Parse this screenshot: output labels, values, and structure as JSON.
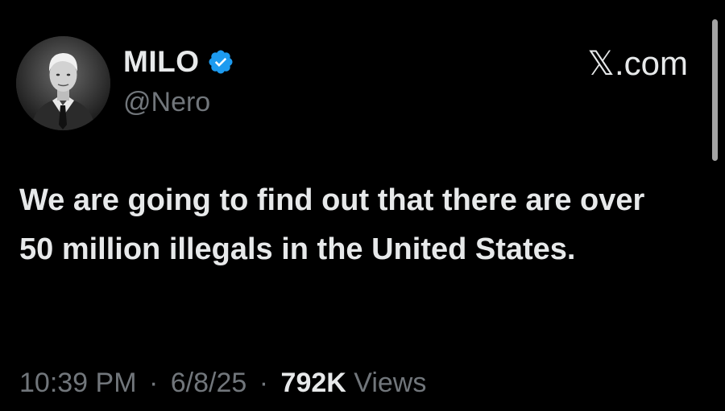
{
  "tweet": {
    "author": {
      "display_name": "MILO",
      "handle": "@Nero",
      "verified_icon": "verified-badge-icon",
      "verified_color": "#1d9bf0"
    },
    "brand": "𝕏.com",
    "text": "We are going to find out that there are over 50 million illegals in the United States.",
    "time": "10:39 PM",
    "separator": "·",
    "date": "6/8/25",
    "views_count": "792K",
    "views_label": "Views"
  },
  "colors": {
    "background": "#000000",
    "primary_text": "#e7e9ea",
    "secondary_text": "#71767b",
    "accent": "#1d9bf0"
  }
}
